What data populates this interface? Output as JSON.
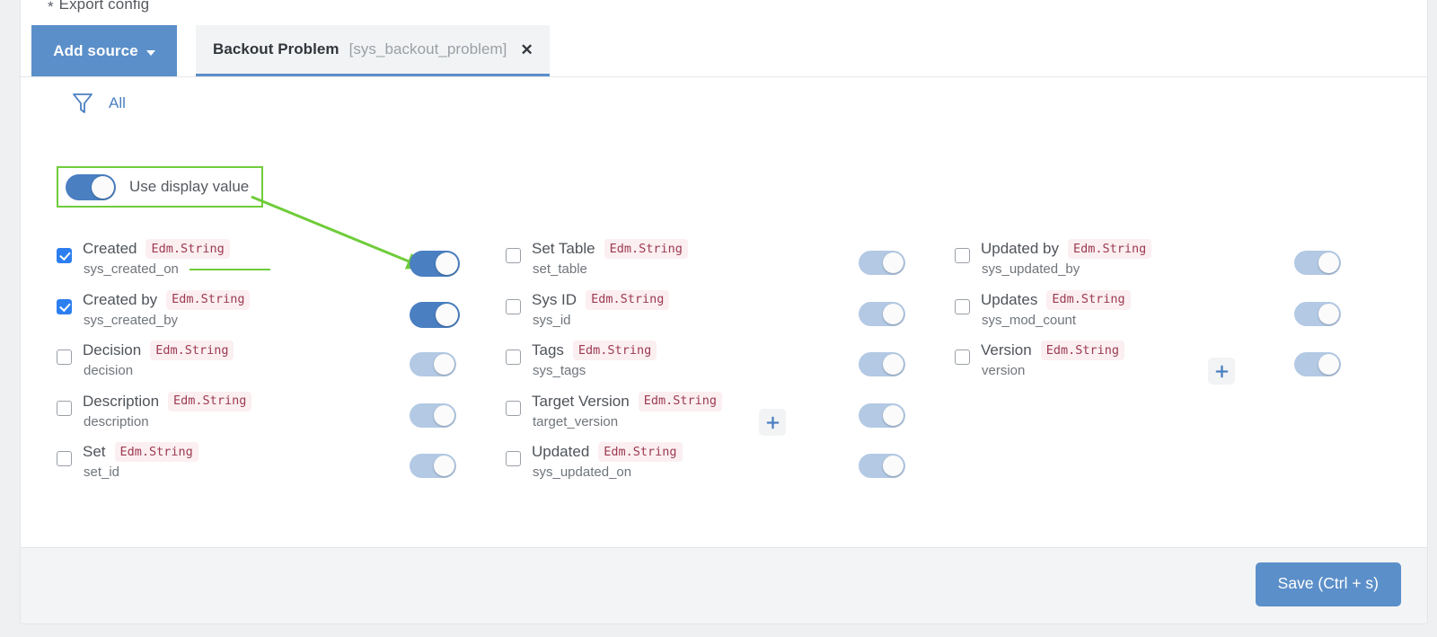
{
  "form": {
    "required_marker": "*",
    "label": "Export config"
  },
  "toolbar": {
    "add_source_label": "Add source",
    "caret_icon": "chevron-down-icon"
  },
  "tab": {
    "title": "Backout Problem",
    "table": "[sys_backout_problem]",
    "close_icon": "✕"
  },
  "filter": {
    "icon": "filter-icon",
    "label": "All"
  },
  "display_value": {
    "label": "Use display value",
    "enabled": true
  },
  "plus_buttons": {
    "column2_label": "+",
    "column3_label": "+"
  },
  "footer": {
    "save_label": "Save (Ctrl + s)"
  },
  "colors": {
    "accent_blue": "#5b8fc9",
    "checkbox_blue": "#2d7ff0",
    "toggle_on": "#4a7fc1",
    "toggle_off": "#b3c9e4",
    "badge_text": "#9d3a52",
    "badge_bg": "#fbeff1",
    "annotation_green": "#6fcc3a"
  },
  "columns": [
    {
      "fields": [
        {
          "label": "Created",
          "type": "Edm.String",
          "name": "sys_created_on",
          "checked": true,
          "toggle": true
        },
        {
          "label": "Created by",
          "type": "Edm.String",
          "name": "sys_created_by",
          "checked": true,
          "toggle": true
        },
        {
          "label": "Decision",
          "type": "Edm.String",
          "name": "decision",
          "checked": false,
          "toggle": false
        },
        {
          "label": "Description",
          "type": "Edm.String",
          "name": "description",
          "checked": false,
          "toggle": false
        },
        {
          "label": "Set",
          "type": "Edm.String",
          "name": "set_id",
          "checked": false,
          "toggle": false
        }
      ]
    },
    {
      "fields": [
        {
          "label": "Set Table",
          "type": "Edm.String",
          "name": "set_table",
          "checked": false,
          "toggle": false
        },
        {
          "label": "Sys ID",
          "type": "Edm.String",
          "name": "sys_id",
          "checked": false,
          "toggle": false
        },
        {
          "label": "Tags",
          "type": "Edm.String",
          "name": "sys_tags",
          "checked": false,
          "toggle": false
        },
        {
          "label": "Target Version",
          "type": "Edm.String",
          "name": "target_version",
          "checked": false,
          "toggle": false
        },
        {
          "label": "Updated",
          "type": "Edm.String",
          "name": "sys_updated_on",
          "checked": false,
          "toggle": false
        }
      ]
    },
    {
      "fields": [
        {
          "label": "Updated by",
          "type": "Edm.String",
          "name": "sys_updated_by",
          "checked": false,
          "toggle": false
        },
        {
          "label": "Updates",
          "type": "Edm.String",
          "name": "sys_mod_count",
          "checked": false,
          "toggle": false
        },
        {
          "label": "Version",
          "type": "Edm.String",
          "name": "version",
          "checked": false,
          "toggle": false
        }
      ]
    }
  ]
}
